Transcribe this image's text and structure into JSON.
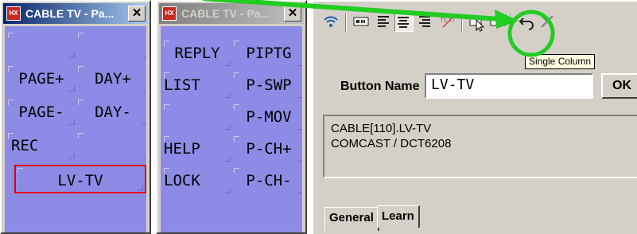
{
  "windows": [
    {
      "title": "CABLE TV - Pa...",
      "close": "✕",
      "buttons": [
        [
          "",
          ""
        ],
        [
          "PAGE+",
          "DAY+"
        ],
        [
          "PAGE-",
          "DAY-"
        ],
        [
          "REC",
          ""
        ],
        [
          "LV-TV",
          null
        ]
      ]
    },
    {
      "title": "CABLE TV - Pa...",
      "close": "✕",
      "buttons": [
        [
          "REPLY",
          "PIPTG"
        ],
        [
          "LIST",
          "P-SWP"
        ],
        [
          "",
          "P-MOV"
        ],
        [
          "HELP",
          "P-CH+"
        ],
        [
          "LOCK",
          "P-CH-"
        ]
      ]
    }
  ],
  "toolbar": {
    "items": [
      "wifi-icon",
      "remote-icon",
      "align-left-icon",
      "align-center-icon",
      "align-right-icon",
      "text-icon",
      "single-column-icon",
      "double-column-icon",
      "undo-icon",
      "close-icon"
    ],
    "tooltip": "Single Column"
  },
  "editor": {
    "button_name_label": "Button Name",
    "button_name_value": "LV-TV",
    "ok_label": "OK",
    "info_line1": "CABLE[110].LV-TV",
    "info_line2": "COMCAST / DCT6208"
  },
  "tabs": [
    "General",
    "Learn"
  ],
  "colors": {
    "button_pad": "#8c8ce6",
    "highlight_circle": "#22cc22",
    "arrow": "#22cc22",
    "selected_border": "#e00000"
  }
}
